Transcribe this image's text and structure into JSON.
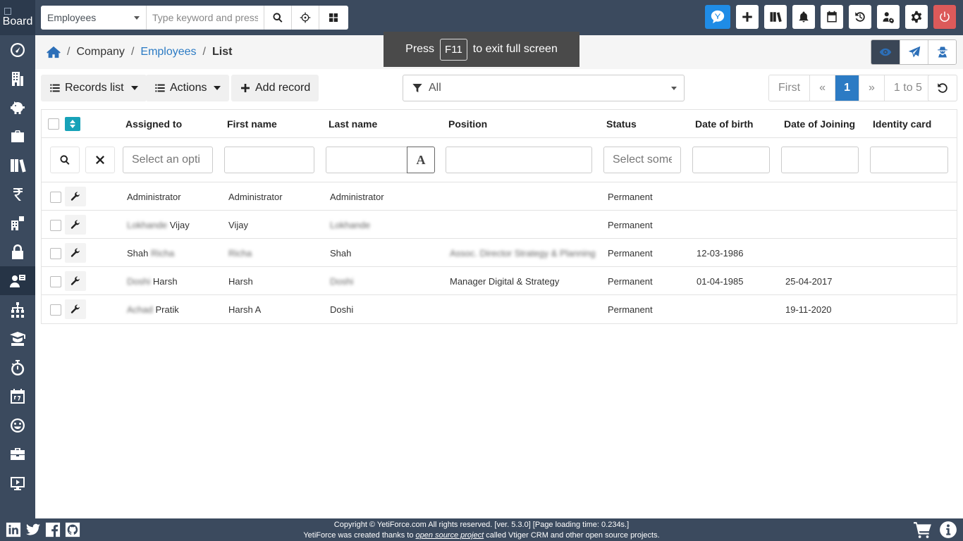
{
  "sidebar": {
    "logo_text": "Board",
    "items": [
      {
        "icon": "dashboard-icon"
      },
      {
        "icon": "building-icon"
      },
      {
        "icon": "piggy-bank-icon"
      },
      {
        "icon": "briefcase-icon"
      },
      {
        "icon": "books-icon"
      },
      {
        "icon": "rupee-icon"
      },
      {
        "icon": "company-icon"
      },
      {
        "icon": "lock-icon"
      },
      {
        "icon": "user-card-icon"
      },
      {
        "icon": "sitemap-icon"
      },
      {
        "icon": "graduate-icon"
      },
      {
        "icon": "stopwatch-icon"
      },
      {
        "icon": "calendar-icon"
      },
      {
        "icon": "smile-icon"
      },
      {
        "icon": "toolbox-icon"
      },
      {
        "icon": "monitor-icon"
      }
    ]
  },
  "header": {
    "module_select": "Employees",
    "search_placeholder": "Type keyword and press"
  },
  "fullscreen": {
    "pre": "Press",
    "key": "F11",
    "post": "to exit full screen"
  },
  "breadcrumb": {
    "company": "Company",
    "employees": "Employees",
    "current": "List"
  },
  "toolbar": {
    "records_list": "Records list",
    "actions": "Actions",
    "add_record": "Add record",
    "filter": "All",
    "pagination": {
      "first": "First",
      "prev": "«",
      "page": "1",
      "next": "»",
      "range": "1 to 5"
    }
  },
  "table": {
    "columns": {
      "assigned_to": "Assigned to",
      "first_name": "First name",
      "last_name": "Last name",
      "position": "Position",
      "status": "Status",
      "date_of_birth": "Date of birth",
      "date_of_joining": "Date of Joining",
      "identity_card": "Identity card"
    },
    "filters": {
      "assigned_placeholder": "Select an opti",
      "status_placeholder": "Select some",
      "case_toggle": "A"
    },
    "rows": [
      {
        "assigned_a": "Administrator",
        "assigned_b": "",
        "first_name": "Administrator",
        "last_name": "Administrator",
        "position": "",
        "status": "Permanent",
        "dob": "",
        "doj": ""
      },
      {
        "assigned_a": "Lokhande",
        "assigned_b": "Vijay",
        "first_name": "Vijay",
        "last_name": "Lokhande",
        "position": "",
        "status": "Permanent",
        "dob": "",
        "doj": ""
      },
      {
        "assigned_a": "Shah",
        "assigned_b": "Richa",
        "first_name": "Richa",
        "last_name": "Shah",
        "position": "Assoc. Director Strategy & Planning",
        "status": "Permanent",
        "dob": "12-03-1986",
        "doj": ""
      },
      {
        "assigned_a": "Doshi",
        "assigned_b": "Harsh",
        "first_name": "Harsh",
        "last_name": "Doshi",
        "position": "Manager Digital & Strategy",
        "status": "Permanent",
        "dob": "01-04-1985",
        "doj": "25-04-2017"
      },
      {
        "assigned_a": "Achad",
        "assigned_b": "Pratik",
        "first_name": "Harsh A",
        "last_name": "Doshi",
        "position": "",
        "status": "Permanent",
        "dob": "",
        "doj": "19-11-2020"
      }
    ]
  },
  "footer": {
    "line1": "Copyright © YetiForce.com All rights reserved. [ver. 5.3.0] [Page loading time: 0.234s.]",
    "line2_pre": "YetiForce was created thanks to",
    "line2_link": "open source project",
    "line2_post": "called Vtiger CRM and other open source projects."
  }
}
